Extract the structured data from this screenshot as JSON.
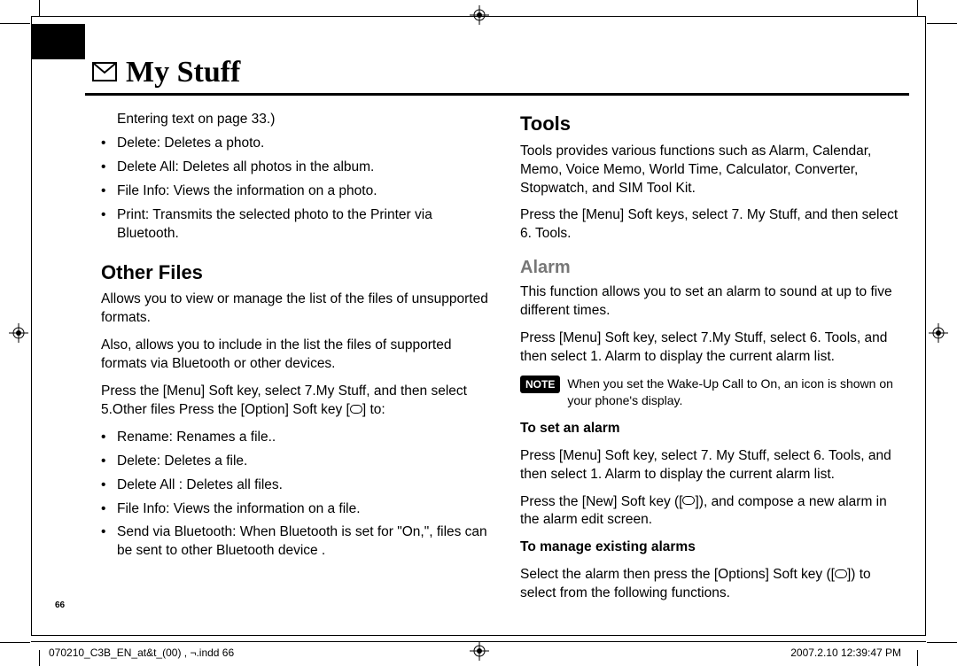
{
  "header": {
    "title": "My Stuff",
    "icon_name": "envelope-icon"
  },
  "left_column": {
    "lead_text": "Entering text on page 33.)",
    "bullets_a": [
      "Delete: Deletes a photo.",
      "Delete All: Deletes all photos in the album.",
      "File Info: Views the information on a photo.",
      "Print: Transmits the selected photo to the Printer via Bluetooth."
    ],
    "section_title": "Other Files",
    "para1": "Allows you to view or manage the list of the files of unsupported formats.",
    "para2": "Also, allows you to include in the list the files of supported formats via Bluetooth or other devices.",
    "para3_pre": "Press the [Menu] Soft key, select 7.My Stuff, and then select 5.Other files Press the [Option] Soft key [",
    "para3_post": "] to:",
    "bullets_b": [
      "Rename: Renames a file..",
      "Delete: Deletes a file.",
      "Delete All : Deletes all files.",
      "File Info: Views the information on a file.",
      "Send via Bluetooth: When Bluetooth is set for \"On,\", files can be sent to other Bluetooth device ."
    ]
  },
  "right_column": {
    "section_title": "Tools",
    "para1": "Tools provides various functions such as Alarm, Calendar, Memo, Voice Memo, World Time, Calculator, Converter, Stopwatch, and SIM Tool Kit.",
    "para2": "Press the [Menu] Soft keys, select 7. My Stuff, and then select 6. Tools.",
    "sub_title": "Alarm",
    "para3": "This function allows you to set an alarm to sound at up to five different times.",
    "para4": "Press [Menu] Soft key, select 7.My Stuff, select 6. Tools, and then select 1. Alarm to display the current alarm list.",
    "note_label": "NOTE",
    "note_text": "When you set the Wake-Up Call to On, an icon is shown on your phone's display.",
    "h_set": "To set an alarm",
    "para5": "Press [Menu] Soft key, select 7. My Stuff, select 6. Tools, and then select 1. Alarm to display the current alarm list.",
    "para6_pre": "Press the [New] Soft key ([",
    "para6_post": "]), and compose a new alarm in the alarm edit screen.",
    "h_manage": "To manage existing alarms",
    "para7_pre": "Select the alarm then press the [Options] Soft key ([",
    "para7_post": "]) to select from the following functions."
  },
  "page_number": "66",
  "footer": {
    "left": "070210_C3B_EN_at&t_(00) , ¬.indd   66",
    "right": "2007.2.10   12:39:47 PM"
  }
}
